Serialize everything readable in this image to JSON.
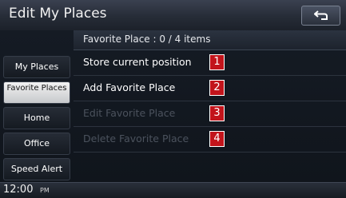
{
  "title": "Edit My Places",
  "header": {
    "text": "Favorite Place : 0 / 4 items"
  },
  "sidebar": {
    "items": [
      {
        "label": "My Places",
        "active": false
      },
      {
        "label": "Favorite Places",
        "active": true
      },
      {
        "label": "Home",
        "active": false
      },
      {
        "label": "Office",
        "active": false
      },
      {
        "label": "Speed Alert",
        "active": false
      }
    ]
  },
  "menu": {
    "items": [
      {
        "label": "Store current position",
        "number": "1",
        "enabled": true
      },
      {
        "label": "Add Favorite Place",
        "number": "2",
        "enabled": true
      },
      {
        "label": "Edit Favorite Place",
        "number": "3",
        "enabled": false
      },
      {
        "label": "Delete Favorite Place",
        "number": "4",
        "enabled": false
      }
    ]
  },
  "status": {
    "time": "12:00",
    "ampm": "PM"
  },
  "colors": {
    "badge": "#c2141b",
    "background": "#0c1016",
    "disabled_text": "#4b525d"
  }
}
